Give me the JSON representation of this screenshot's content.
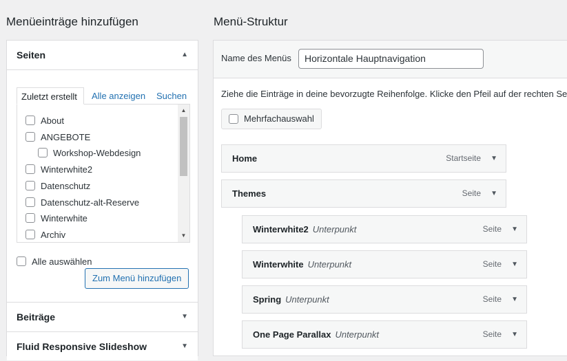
{
  "left": {
    "heading": "Menüeinträge hinzufügen",
    "sections": {
      "pages": {
        "title": "Seiten",
        "tabs": [
          "Zuletzt erstellt",
          "Alle anzeigen",
          "Suchen"
        ],
        "items": [
          {
            "label": "About"
          },
          {
            "label": "ANGEBOTE"
          },
          {
            "label": "Workshop-Webdesign"
          },
          {
            "label": "Winterwhite2"
          },
          {
            "label": "Datenschutz"
          },
          {
            "label": "Datenschutz-alt-Reserve"
          },
          {
            "label": "Winterwhite"
          },
          {
            "label": "Archiv"
          }
        ],
        "select_all_label": "Alle auswählen",
        "add_button_label": "Zum Menü hinzufügen"
      },
      "posts": {
        "title": "Beiträge"
      },
      "slideshow": {
        "title": "Fluid Responsive Slideshow"
      }
    }
  },
  "right": {
    "heading": "Menü-Struktur",
    "menu_name_label": "Name des Menüs",
    "menu_name_value": "Horizontale Hauptnavigation",
    "instructions": "Ziehe die Einträge in deine bevorzugte Reihenfolge. Klicke den Pfeil auf der rechten Seite",
    "multi_select_label": "Mehrfachauswahl",
    "items": [
      {
        "title": "Home",
        "sub": "",
        "type": "Startseite"
      },
      {
        "title": "Themes",
        "sub": "",
        "type": "Seite"
      },
      {
        "title": "Winterwhite2",
        "sub": "Unterpunkt",
        "type": "Seite"
      },
      {
        "title": "Winterwhite",
        "sub": "Unterpunkt",
        "type": "Seite"
      },
      {
        "title": "Spring",
        "sub": "Unterpunkt",
        "type": "Seite"
      },
      {
        "title": "One Page Parallax",
        "sub": "Unterpunkt",
        "type": "Seite"
      }
    ]
  },
  "colors": {
    "link": "#2271b1",
    "background": "#f0f0f1",
    "border": "#dcdcde"
  }
}
